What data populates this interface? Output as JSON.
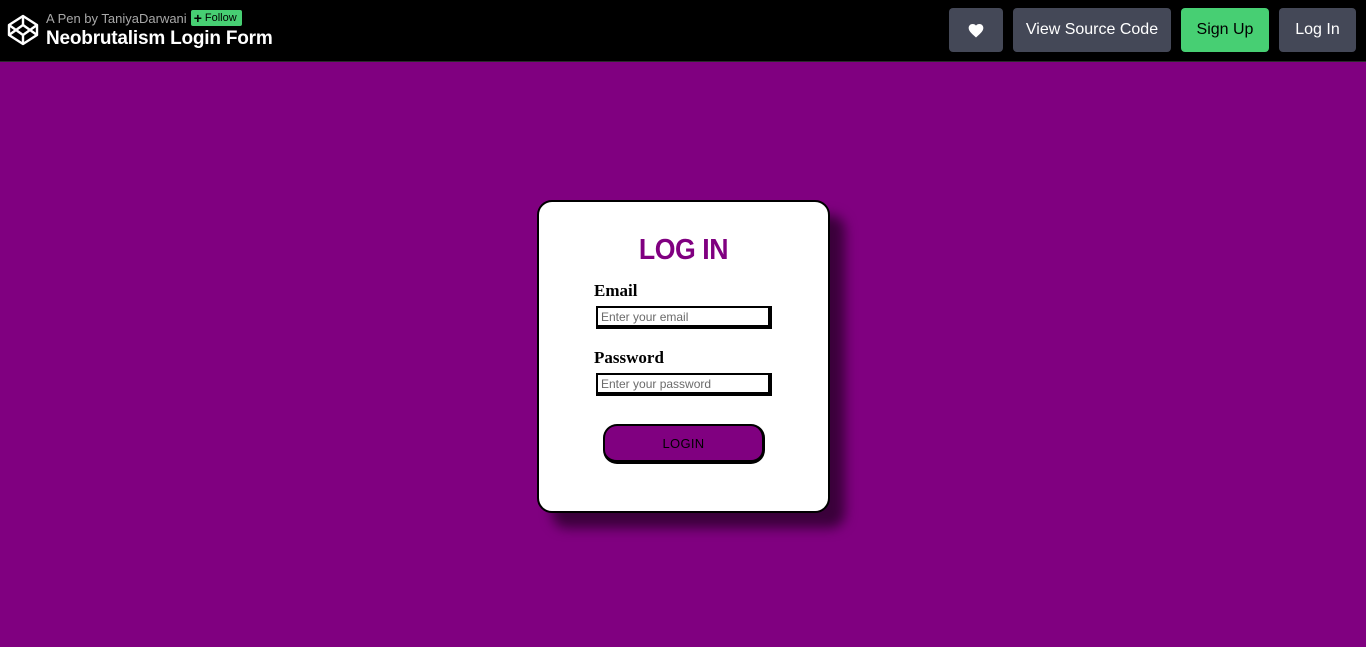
{
  "header": {
    "logo_icon": "codepen-logo-icon",
    "pen_by": "A Pen by TaniyaDarwani",
    "follow_label": "Follow",
    "pen_title": "Neobrutalism Login Form",
    "heart_icon": "heart-icon",
    "view_source_label": "View Source Code",
    "signup_label": "Sign Up",
    "login_label": "Log In",
    "colors": {
      "bar": "#000000",
      "button": "#444857",
      "accent_green": "#47cf73"
    }
  },
  "form": {
    "title": "LOG IN",
    "email_label": "Email",
    "email_placeholder": "Enter your email",
    "email_value": "",
    "password_label": "Password",
    "password_placeholder": "Enter your password",
    "password_value": "",
    "submit_label": "LOGIN",
    "colors": {
      "page_background": "#800080",
      "title": "#800080",
      "button": "#800080",
      "card": "#ffffff"
    }
  }
}
